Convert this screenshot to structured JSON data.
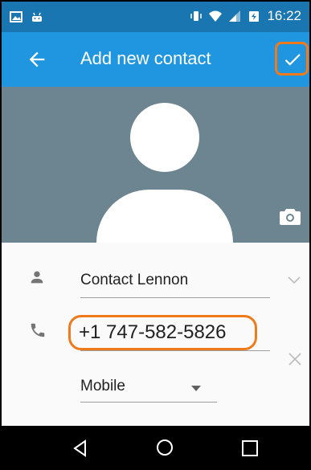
{
  "status_bar": {
    "time": "16:22",
    "icons": [
      "image-notification-icon",
      "android-notification-icon",
      "vibrate-icon",
      "wifi-icon",
      "signal-icon",
      "battery-icon"
    ]
  },
  "app_bar": {
    "title": "Add new contact",
    "back_icon": "arrow-back-icon",
    "save_icon": "check-icon",
    "color": "#2196e0"
  },
  "photo": {
    "background": "#6d8591",
    "camera_icon": "camera-icon"
  },
  "form": {
    "name": "Contact Lennon",
    "phone": "+1 747-582-5826",
    "phone_type": "Mobile"
  },
  "nav_bar": {
    "icons": [
      "nav-back-icon",
      "nav-home-icon",
      "nav-recent-icon"
    ]
  },
  "highlight_color": "#f07a1a"
}
